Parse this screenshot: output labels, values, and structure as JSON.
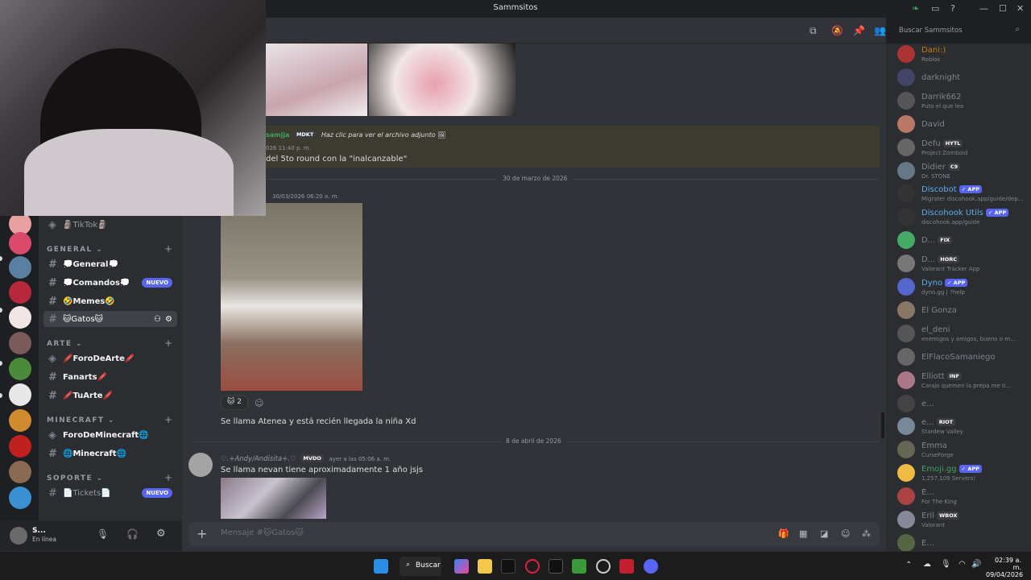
{
  "window": {
    "title": "Sammsitos",
    "controls": [
      "—",
      "☐",
      "✕"
    ]
  },
  "search": {
    "placeholder": "Buscar Sammsitos"
  },
  "categories": [
    {
      "label": "GENERAL"
    },
    {
      "label": "ARTE"
    },
    {
      "label": "MINECRAFT"
    },
    {
      "label": "SOPORTE"
    }
  ],
  "channels": {
    "tiktok": "🗿TikTok🗿",
    "general": "💭General💭",
    "comandos": "💭Comandos💭",
    "memes": "🤣Memes🤣",
    "gatos": "🐱Gatos🐱",
    "foro_arte": "🖍️ForoDeArte🖍️",
    "fanarts": "Fanarts🖍️",
    "tuarte": "🖍️TuArte🖍️",
    "foro_minecraft": "ForoDeMinecraft🌐",
    "minecraft": "🌐Minecraft🌐",
    "tickets": "📄Tickets📄",
    "new_badge": "NUEVO"
  },
  "user": {
    "status": "En línea"
  },
  "messages": {
    "reply_author": "samjja",
    "reply_tag": "MDKT",
    "reply_text": "Haz clic para ver el archivo adjunto",
    "reply_time": "026 11:40 p. m.",
    "reply_body": "del 5to round con la \"inalcanzable\"",
    "divider1": "30 de marzo de 2026",
    "msg1_time": "30/03/2026 06:20 a. m.",
    "reaction_count": "2",
    "msg1_text": "Se llama Atenea y está recién llegada la niña Xd",
    "divider2": "8 de abril de 2026",
    "msg2_author": "♡.+Andy/Andisita+.♡",
    "msg2_tag": "MVDO",
    "msg2_time": "ayer a las 05:06 a. m.",
    "msg2_text": "Se llama nevan tiene aproximadamente 1 año jsjs"
  },
  "composer": {
    "placeholder": "Mensaje #🐱Gatos🐱"
  },
  "members": [
    {
      "name": "Dani:)",
      "status": "Roblox",
      "color": "#c27c0e",
      "tag": ""
    },
    {
      "name": "darknight",
      "status": "",
      "color": "#80848e",
      "tag": ""
    },
    {
      "name": "Darrik662",
      "status": "Puto el que lea",
      "color": "#80848e",
      "tag": ""
    },
    {
      "name": "David",
      "status": "",
      "color": "#80848e",
      "tag": ""
    },
    {
      "name": "Defu",
      "status": "Project Zomboid",
      "color": "#80848e",
      "tag": "HYTL"
    },
    {
      "name": "Didier",
      "status": "Dr. STONE",
      "color": "#80848e",
      "tag": "C9"
    },
    {
      "name": "Discobot",
      "status": "Migrate! discohook.app/guide/dep...",
      "color": "#5dadec",
      "tag": "APP"
    },
    {
      "name": "Discohook Utils",
      "status": "discohook.app/guide",
      "color": "#5dadec",
      "tag": "APP"
    },
    {
      "name": "D...",
      "status": "",
      "color": "#80848e",
      "tag": "FIX"
    },
    {
      "name": "D...",
      "status": "Valorant Tracker App",
      "color": "#80848e",
      "tag": "HORC"
    },
    {
      "name": "Dyno",
      "status": "dyno.gg | ?help",
      "color": "#5dadec",
      "tag": "APP"
    },
    {
      "name": "El Gonza",
      "status": "",
      "color": "#80848e",
      "tag": ""
    },
    {
      "name": "el_deni",
      "status": "enemigos y amigos, bueno o m...",
      "color": "#80848e",
      "tag": ""
    },
    {
      "name": "ElFlacoSamaniego",
      "status": "",
      "color": "#80848e",
      "tag": ""
    },
    {
      "name": "Elliott",
      "status": "Carajo quemen la prepa me ti...",
      "color": "#80848e",
      "tag": "INF"
    },
    {
      "name": "e...",
      "status": "",
      "color": "#80848e",
      "tag": ""
    },
    {
      "name": "e...",
      "status": "Stardew Valley",
      "color": "#80848e",
      "tag": "RIOT"
    },
    {
      "name": "Emma",
      "status": "CurseForge",
      "color": "#80848e",
      "tag": ""
    },
    {
      "name": "Emoji.gg",
      "status": "1,257,109 Servers!",
      "color": "#3ba55d",
      "tag": "APP"
    },
    {
      "name": "E...",
      "status": "For The King",
      "color": "#80848e",
      "tag": ""
    },
    {
      "name": "Eril",
      "status": "Valorant",
      "color": "#80848e",
      "tag": "WBOX"
    },
    {
      "name": "E...",
      "status": "",
      "color": "#80848e",
      "tag": ""
    }
  ],
  "taskbar": {
    "search_label": "Buscar",
    "time": "02:39 a. m.",
    "date": "09/04/2026"
  }
}
